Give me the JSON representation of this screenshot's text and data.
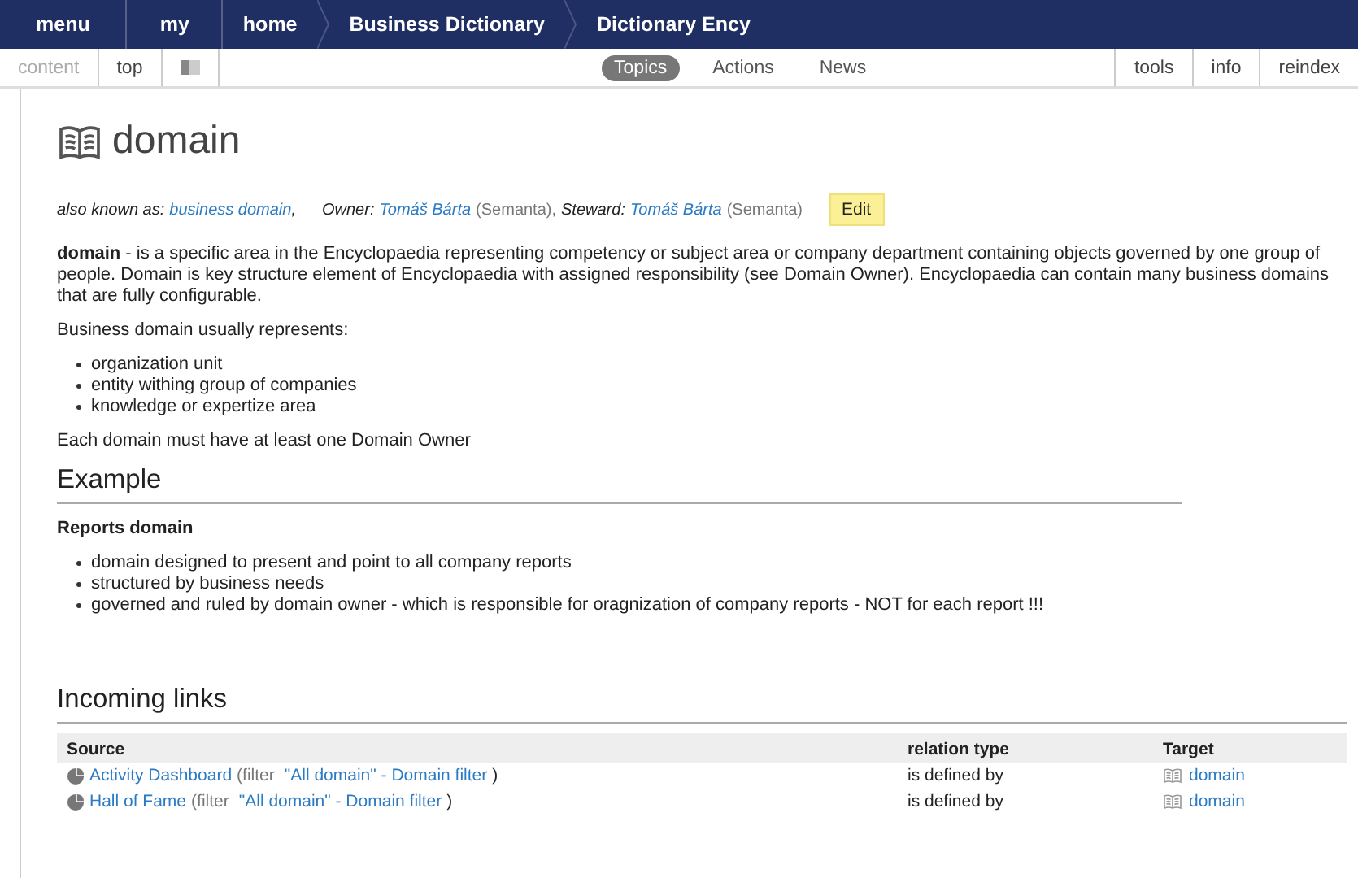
{
  "nav": {
    "items": [
      {
        "label": "menu",
        "kind": "plain"
      },
      {
        "label": "my",
        "kind": "plain"
      },
      {
        "label": "home",
        "kind": "crumb"
      },
      {
        "label": "Business Dictionary",
        "kind": "crumb"
      },
      {
        "label": "Dictionary Ency",
        "kind": "crumb"
      }
    ]
  },
  "toolbar": {
    "left": [
      {
        "label": "content",
        "disabled": true
      },
      {
        "label": "top",
        "disabled": false
      }
    ],
    "tabs": [
      {
        "label": "Topics",
        "selected": true
      },
      {
        "label": "Actions",
        "selected": false
      },
      {
        "label": "News",
        "selected": false
      }
    ],
    "right": [
      {
        "label": "tools"
      },
      {
        "label": "info"
      },
      {
        "label": "reindex"
      }
    ]
  },
  "page": {
    "title": "domain",
    "meta": {
      "aka_label": "also known as:",
      "aka": "business domain",
      "aka_sep": ",",
      "owner_label": "Owner:",
      "owner": "Tomáš Bárta",
      "owner_org": "(Semanta),",
      "steward_label": "Steward:",
      "steward": "Tomáš Bárta",
      "steward_org": "(Semanta)",
      "edit": "Edit"
    },
    "intro": "**domain** - is a specific area in the Encyclopaedia representing competency or subject area or company department containing objects governed by one group of people. Domain is key structure element of Encyclopaedia with assigned responsibility (see Domain Owner). Encyclopaedia can contain many business domains that are fully configurable.",
    "list_intro": "Business domain usually represents:",
    "list": [
      "organization unit",
      "entity withing group of companies",
      "knowledge or expertize area"
    ],
    "note": "Each domain must have at least one Domain Owner",
    "example": {
      "heading": "Example",
      "subheading": "Reports domain",
      "list": [
        "domain designed to present and point to all company reports",
        "structured by business needs",
        "governed and ruled by domain owner - which is responsible for oragnization of company reports - NOT for each report !!!"
      ]
    },
    "incoming": {
      "heading": "Incoming links",
      "columns": [
        "Source",
        "relation type",
        "Target"
      ],
      "rows": [
        {
          "source": "Activity Dashboard",
          "filter_prefix": "(filter",
          "filter": "\"All domain\" - Domain filter",
          "filter_suffix": ")",
          "relation": "is defined by",
          "target": "domain"
        },
        {
          "source": "Hall of Fame",
          "filter_prefix": "(filter",
          "filter": "\"All domain\" - Domain filter",
          "filter_suffix": ")",
          "relation": "is defined by",
          "target": "domain"
        }
      ]
    }
  }
}
